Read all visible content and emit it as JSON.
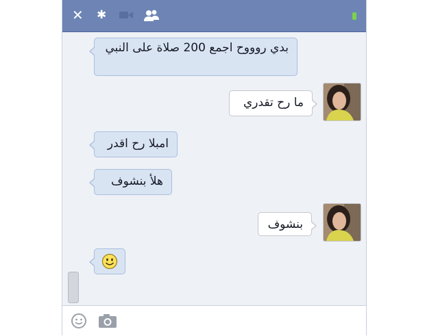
{
  "chat": {
    "titlebar": {
      "close_icon": "close-icon",
      "settings_icon": "gear-icon",
      "video_icon": "video-camera-icon",
      "add_friends_icon": "add-friends-icon",
      "status_color": "#7bd34a"
    },
    "messages": [
      {
        "side": "in",
        "text": "بدي روووح اجمع 200 صلاة على النبي"
      },
      {
        "side": "out",
        "text": "ما رح تقدري"
      },
      {
        "side": "in",
        "text": "امبلا رح اقدر"
      },
      {
        "side": "in",
        "text": "هلأ بنشوف"
      },
      {
        "side": "out",
        "text": "بنشوف"
      },
      {
        "side": "in",
        "emoji": "smiley-emoticon"
      }
    ],
    "composer": {
      "emoticon_icon": "smiley-icon",
      "photo_icon": "camera-icon"
    },
    "colors": {
      "header": "#6d84b4",
      "incoming_bubble": "#d9e4f3",
      "outgoing_bubble": "#ffffff"
    }
  }
}
